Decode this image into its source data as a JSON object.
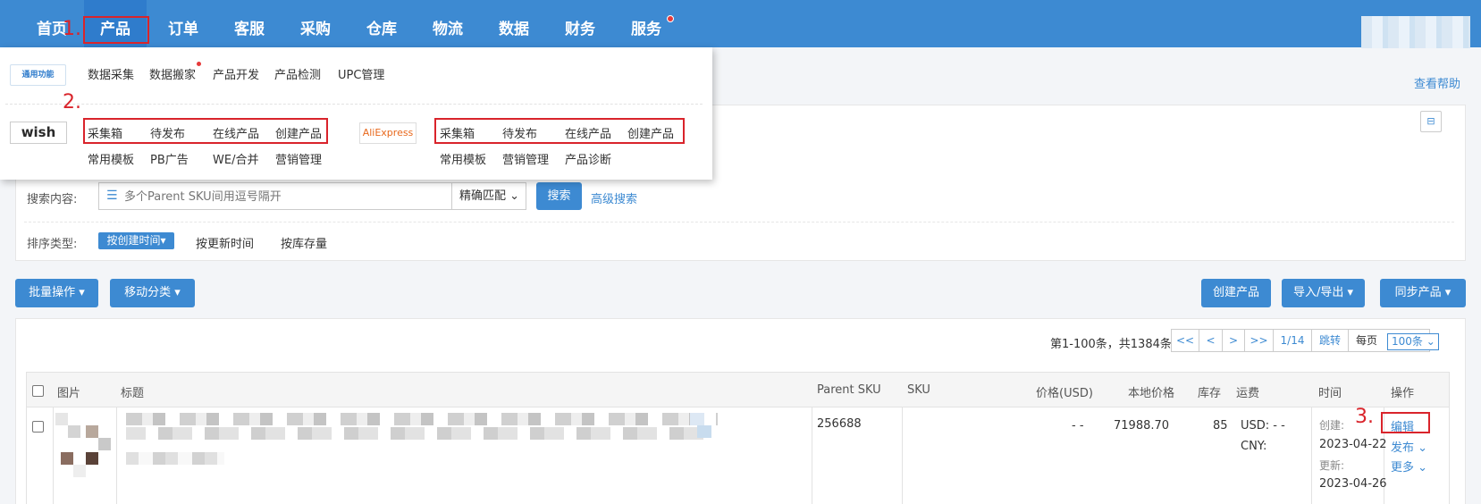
{
  "nav": {
    "items": [
      "首页",
      "产品",
      "订单",
      "客服",
      "采购",
      "仓库",
      "物流",
      "数据",
      "财务",
      "服务"
    ]
  },
  "annotations": {
    "step1": "1.",
    "step2": "2.",
    "step3": "3."
  },
  "help_link": "查看帮助",
  "dropdown": {
    "common_badge": "通用功能",
    "common_links": [
      "数据采集",
      "数据搬家",
      "产品开发",
      "产品检测",
      "UPC管理"
    ],
    "wish_logo": "wish",
    "wish_row1": [
      "采集箱",
      "待发布",
      "在线产品",
      "创建产品"
    ],
    "wish_row2": [
      "常用模板",
      "PB广告",
      "WE/合并",
      "营销管理"
    ],
    "ali_logo": "AliExpress",
    "ali_row1": [
      "采集箱",
      "待发布",
      "在线产品",
      "创建产品"
    ],
    "ali_row2": [
      "常用模板",
      "营销管理",
      "产品诊断"
    ]
  },
  "filters": {
    "search_label": "搜索内容:",
    "search_placeholder": "多个Parent SKU间用逗号隔开",
    "match_mode": "精确匹配",
    "search_button": "搜索",
    "advanced_search": "高级搜索",
    "sort_label": "排序类型:",
    "sort_options": [
      "按创建时间",
      "按更新时间",
      "按库存量"
    ]
  },
  "toolbar": {
    "bulk": "批量操作",
    "move": "移动分类",
    "create": "创建产品",
    "import_export": "导入/导出",
    "sync": "同步产品"
  },
  "pagination": {
    "summary": "第1-100条，共1384条",
    "first": "<<",
    "prev": "<",
    "next": ">",
    "last": ">>",
    "page": "1/14",
    "jump": "跳转",
    "per_page_label": "每页",
    "per_page": "100条"
  },
  "table": {
    "headers": [
      "图片",
      "标题",
      "Parent SKU",
      "SKU",
      "价格(USD)",
      "本地价格",
      "库存",
      "运费",
      "时间",
      "操作"
    ],
    "row": {
      "parent_sku": "256688",
      "price_usd": "- -",
      "local_price": "71988.70",
      "stock": "85",
      "shipping_usd": "USD: - -",
      "shipping_cny": "CNY:",
      "created_label": "创建:",
      "created": "2023-04-22",
      "updated_label": "更新:",
      "updated": "2023-04-26",
      "action_edit": "编辑",
      "action_publish": "发布 ⌄",
      "action_more": "更多 ⌄"
    }
  },
  "colors": {
    "nav": "#3d8ad2",
    "accent": "#3d8ad2",
    "annotation": "#d9242b"
  }
}
